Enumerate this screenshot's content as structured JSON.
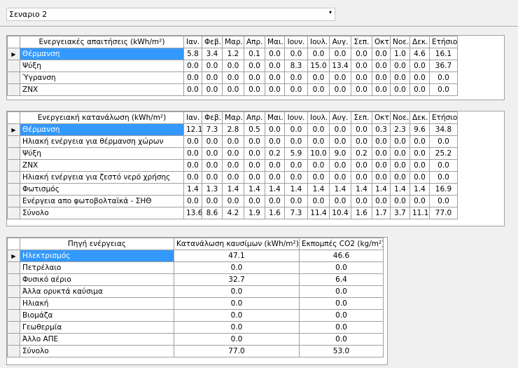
{
  "scenario": {
    "selected": "Σεναριο 2",
    "arrow": "▾"
  },
  "row_marker": "▶",
  "months": [
    "Ιαν.",
    "Φεβ.",
    "Μαρ.",
    "Απρ.",
    "Μαι.",
    "Ιουν.",
    "Ιουλ.",
    "Αυγ.",
    "Σεπ.",
    "Οκτ.",
    "Νοε.",
    "Δεκ.",
    "Ετήσιο"
  ],
  "demand": {
    "header": "Ενεργειακές απαιτήσεις (kWh/m²)",
    "rows": [
      {
        "label": "Θέρμανση",
        "values": [
          "5.8",
          "3.4",
          "1.2",
          "0.1",
          "0.0",
          "0.0",
          "0.0",
          "0.0",
          "0.0",
          "0.0",
          "1.0",
          "4.6",
          "16.1"
        ]
      },
      {
        "label": "Ψύξη",
        "values": [
          "0.0",
          "0.0",
          "0.0",
          "0.0",
          "0.0",
          "8.3",
          "15.0",
          "13.4",
          "0.0",
          "0.0",
          "0.0",
          "0.0",
          "36.7"
        ]
      },
      {
        "label": "Ύγρανση",
        "values": [
          "0.0",
          "0.0",
          "0.0",
          "0.0",
          "0.0",
          "0.0",
          "0.0",
          "0.0",
          "0.0",
          "0.0",
          "0.0",
          "0.0",
          "0.0"
        ]
      },
      {
        "label": "ZNX",
        "values": [
          "0.0",
          "0.0",
          "0.0",
          "0.0",
          "0.0",
          "0.0",
          "0.0",
          "0.0",
          "0.0",
          "0.0",
          "0.0",
          "0.0",
          "0.0"
        ]
      }
    ]
  },
  "consumption": {
    "header": "Ενεργειακή κατανάλωση (kWh/m²)",
    "rows": [
      {
        "label": "Θέρμανση",
        "values": [
          "12.1",
          "7.3",
          "2.8",
          "0.5",
          "0.0",
          "0.0",
          "0.0",
          "0.0",
          "0.0",
          "0.3",
          "2.3",
          "9.6",
          "34.8"
        ]
      },
      {
        "label": "Ηλιακή ενέργεια για θέρμανση χώρων",
        "values": [
          "0.0",
          "0.0",
          "0.0",
          "0.0",
          "0.0",
          "0.0",
          "0.0",
          "0.0",
          "0.0",
          "0.0",
          "0.0",
          "0.0",
          "0.0"
        ]
      },
      {
        "label": "Ψύξη",
        "values": [
          "0.0",
          "0.0",
          "0.0",
          "0.0",
          "0.2",
          "5.9",
          "10.0",
          "9.0",
          "0.2",
          "0.0",
          "0.0",
          "0.0",
          "25.2"
        ]
      },
      {
        "label": "ZNX",
        "values": [
          "0.0",
          "0.0",
          "0.0",
          "0.0",
          "0.0",
          "0.0",
          "0.0",
          "0.0",
          "0.0",
          "0.0",
          "0.0",
          "0.0",
          "0.0"
        ]
      },
      {
        "label": "Ηλιακή ενέργεια για ζεστό νερό χρήσης",
        "values": [
          "0.0",
          "0.0",
          "0.0",
          "0.0",
          "0.0",
          "0.0",
          "0.0",
          "0.0",
          "0.0",
          "0.0",
          "0.0",
          "0.0",
          "0.0"
        ]
      },
      {
        "label": "Φωτισμός",
        "values": [
          "1.4",
          "1.3",
          "1.4",
          "1.4",
          "1.4",
          "1.4",
          "1.4",
          "1.4",
          "1.4",
          "1.4",
          "1.4",
          "1.4",
          "16.9"
        ]
      },
      {
        "label": "Ενέργεια απο φωτοβολταϊκά - ΣΗΘ",
        "values": [
          "0.0",
          "0.0",
          "0.0",
          "0.0",
          "0.0",
          "0.0",
          "0.0",
          "0.0",
          "0.0",
          "0.0",
          "0.0",
          "0.0",
          "0.0"
        ]
      },
      {
        "label": "Σύνολο",
        "values": [
          "13.6",
          "8.6",
          "4.2",
          "1.9",
          "1.6",
          "7.3",
          "11.4",
          "10.4",
          "1.6",
          "1.7",
          "3.7",
          "11.1",
          "77.0"
        ]
      }
    ]
  },
  "sources": {
    "headers": [
      "Πηγή ενέργειας",
      "Κατανάλωση καυσίμων (kWh/m²)",
      "Εκπομπές CO2 (kg/m²)"
    ],
    "rows": [
      {
        "label": "Ηλεκτρισμός",
        "fuel": "47.1",
        "co2": "46.6"
      },
      {
        "label": "Πετρέλαιο",
        "fuel": "0.0",
        "co2": "0.0"
      },
      {
        "label": "Φυσικό αέριο",
        "fuel": "32.7",
        "co2": "6.4"
      },
      {
        "label": "Άλλα ορυκτά καύσιμα",
        "fuel": "0.0",
        "co2": "0.0"
      },
      {
        "label": "Ηλιακή",
        "fuel": "0.0",
        "co2": "0.0"
      },
      {
        "label": "Βιομάζα",
        "fuel": "0.0",
        "co2": "0.0"
      },
      {
        "label": "Γεωθερμία",
        "fuel": "0.0",
        "co2": "0.0"
      },
      {
        "label": "Άλλο ΑΠΕ",
        "fuel": "0.0",
        "co2": "0.0"
      },
      {
        "label": "Σύνολο",
        "fuel": "77.0",
        "co2": "53.0"
      }
    ]
  }
}
